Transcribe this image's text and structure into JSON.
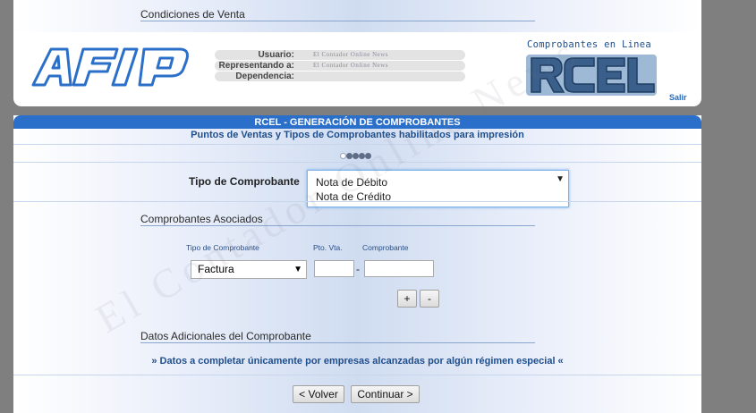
{
  "top_section": {
    "title": "Condiciones de Venta"
  },
  "header": {
    "user_label": "Usuario:",
    "user_value": "El Contador Online News",
    "represent_label": "Representando a:",
    "represent_value": "El Contador Online News",
    "dependency_label": "Dependencia:",
    "dependency_value": "",
    "rcel_caption": "Comprobantes en Linea",
    "logout": "Salir"
  },
  "panel": {
    "title": "RCEL - GENERACIÓN DE COMPROBANTES",
    "subtitle": "Puntos de Ventas y Tipos de Comprobantes habilitados para impresión",
    "tipo_label": "Tipo de Comprobante",
    "tipo_options": [
      "Nota de Débito",
      "Nota de Crédito"
    ],
    "asociados_title": "Comprobantes Asociados",
    "col_tipo": "Tipo de Comprobante",
    "col_pto": "Pto. Vta.",
    "col_comp": "Comprobante",
    "asociado_tipo_value": "Factura",
    "pto_value": "",
    "comp_value": "",
    "separator": "-",
    "add_button": "+",
    "remove_button": "-",
    "datos_title": "Datos Adicionales del Comprobante",
    "datos_note": "» Datos a completar únicamente por empresas alcanzadas por algún régimen especial «",
    "back_button": "< Volver",
    "next_button": "Continuar >"
  },
  "watermark": "El Contador Online News",
  "colors": {
    "brand_blue": "#2a6fc9",
    "text_blue": "#1f4e8c",
    "background_gray": "#7f7f7f"
  }
}
